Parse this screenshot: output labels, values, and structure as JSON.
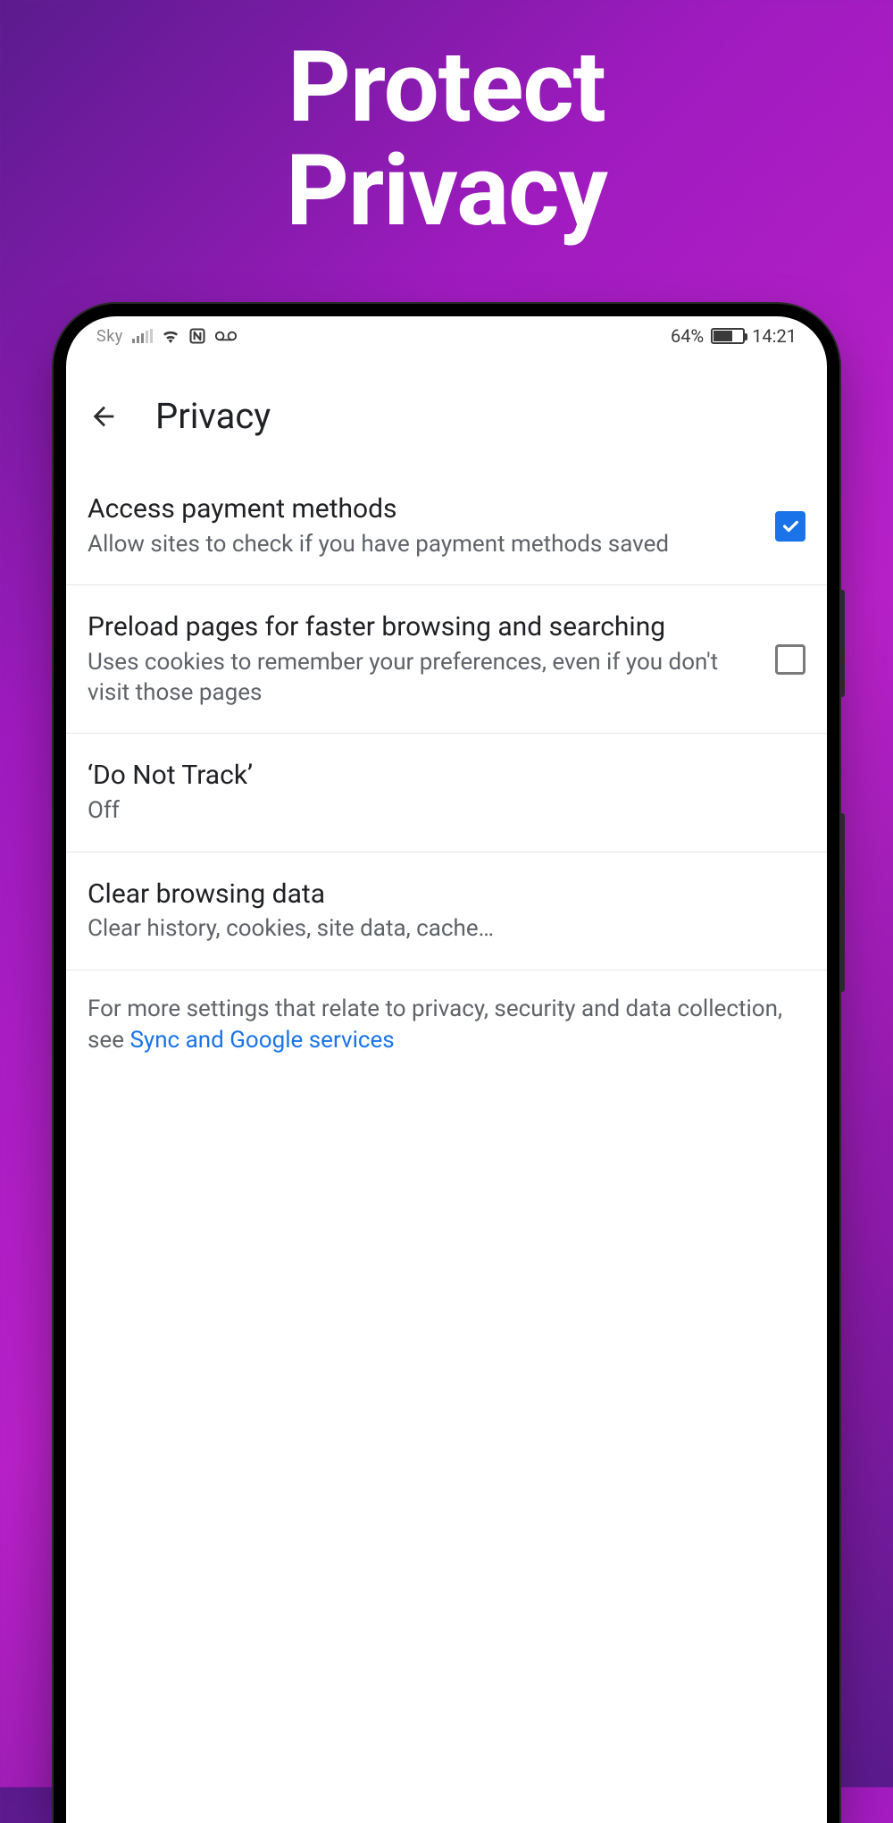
{
  "hero": {
    "line1": "Protect",
    "line2": "Privacy"
  },
  "statusbar": {
    "carrier": "Sky",
    "battery_pct": "64%",
    "time": "14:21"
  },
  "appbar": {
    "title": "Privacy"
  },
  "settings": [
    {
      "title": "Access payment methods",
      "subtitle": "Allow sites to check if you have payment methods saved",
      "checked": true
    },
    {
      "title": "Preload pages for faster browsing and searching",
      "subtitle": "Uses cookies to remember your preferences, even if you don't visit those pages",
      "checked": false
    },
    {
      "title": "‘Do Not Track’",
      "subtitle": "Off"
    },
    {
      "title": "Clear browsing data",
      "subtitle": "Clear history, cookies, site data, cache…"
    }
  ],
  "footnote": {
    "text_before": "For more settings that relate to privacy, security and data collection, see ",
    "link_text": "Sync and Google services"
  }
}
